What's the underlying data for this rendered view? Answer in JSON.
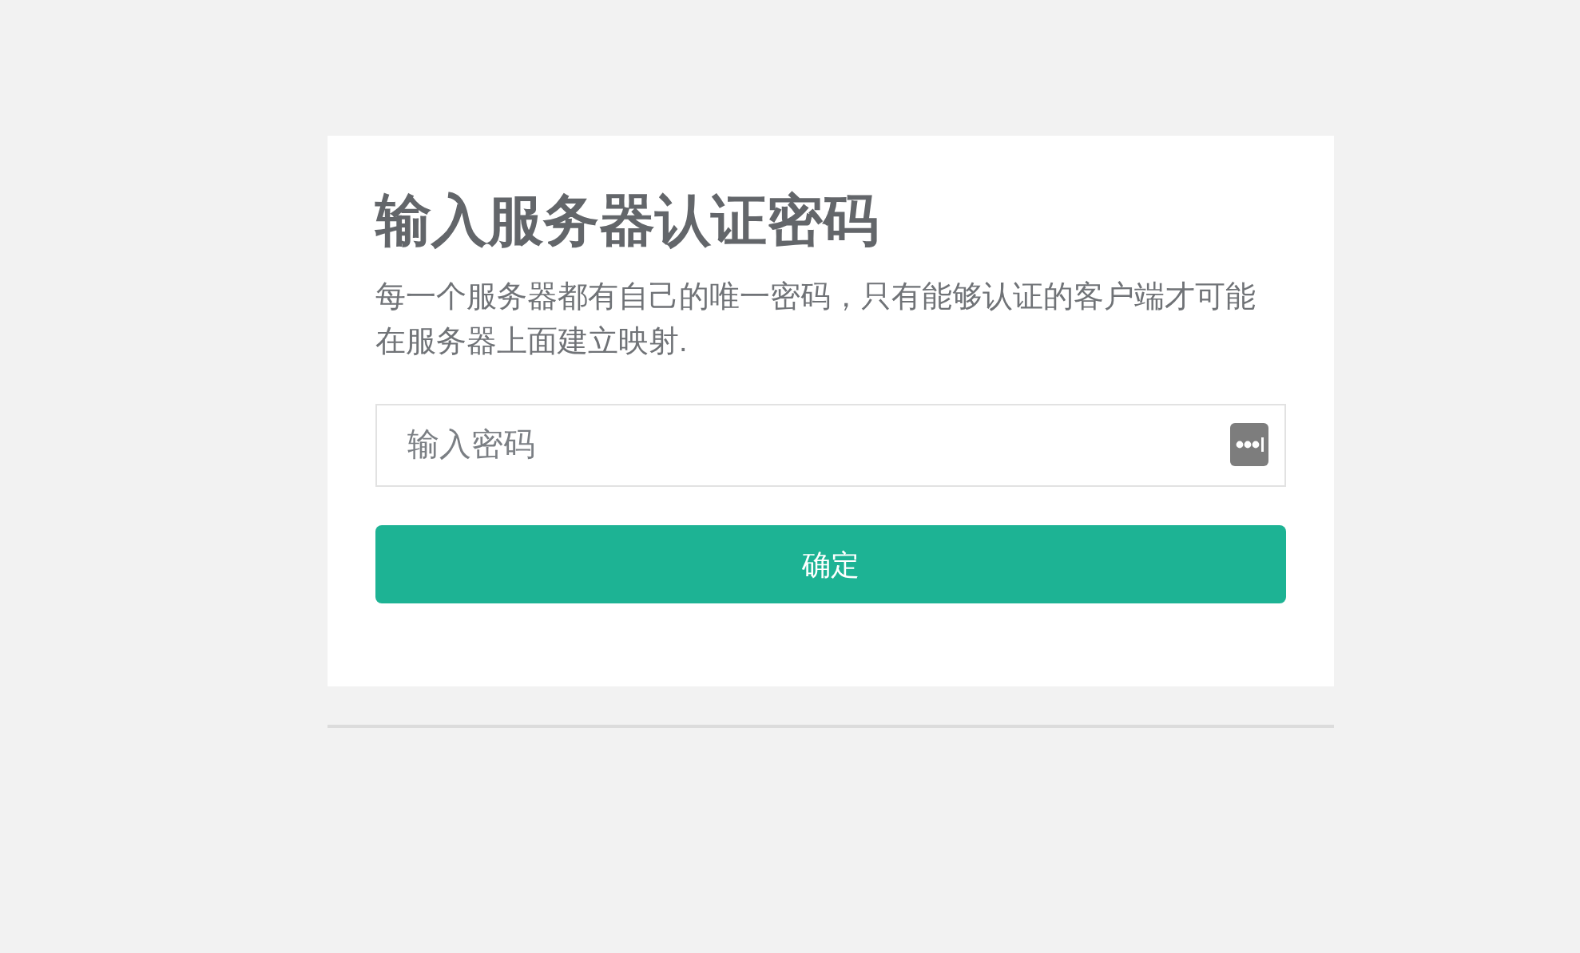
{
  "title": "输入服务器认证密码",
  "description": "每一个服务器都有自己的唯一密码，只有能够认证的客户端才可能在服务器上面建立映射.",
  "password_field": {
    "placeholder": "输入密码"
  },
  "submit_button": {
    "label": "确定"
  }
}
